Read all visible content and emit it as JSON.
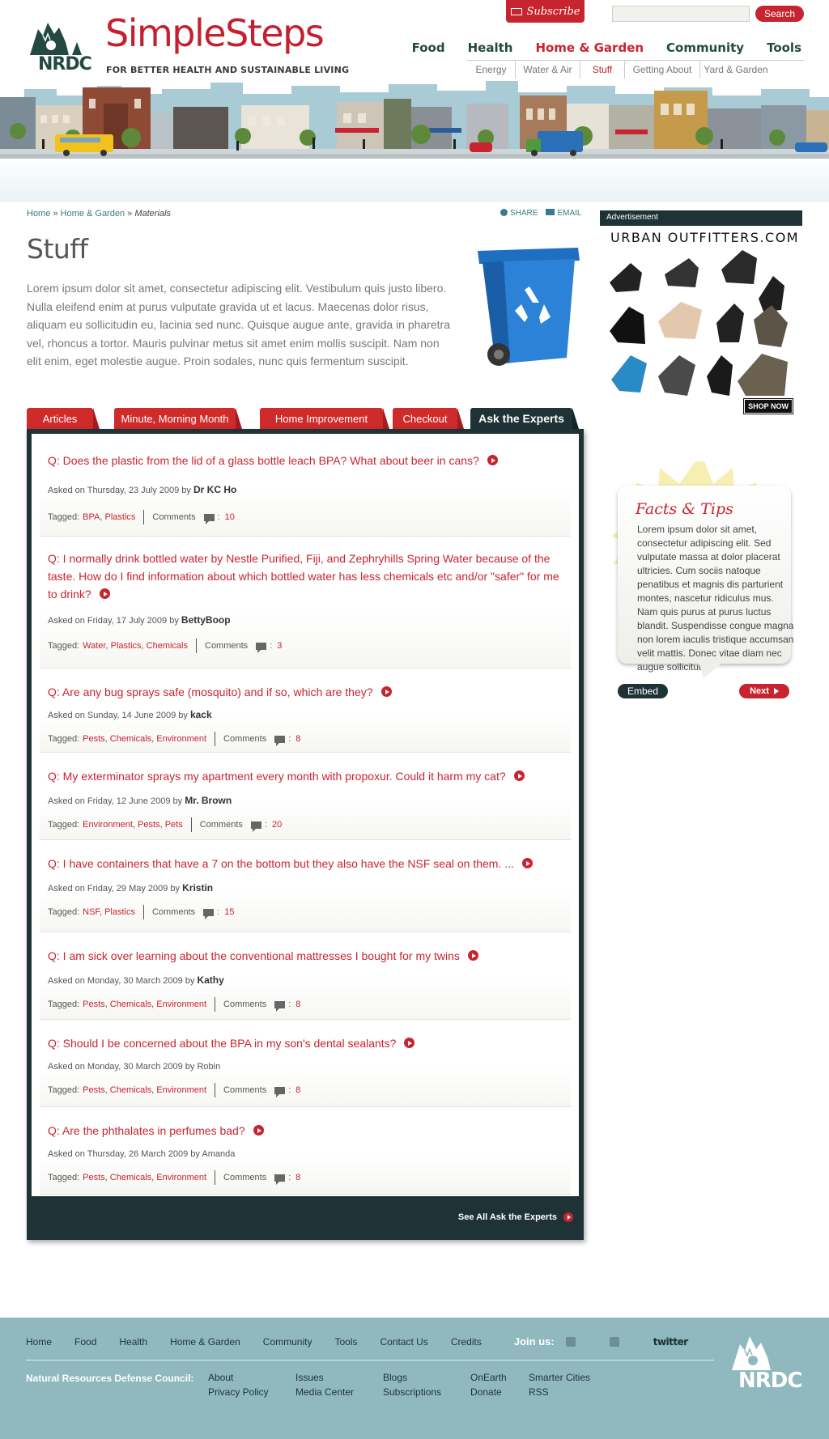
{
  "header": {
    "logo_text": "NRDC",
    "brand": "SimpleSteps",
    "tagline": "FOR BETTER HEALTH AND SUSTAINABLE LIVING",
    "subscribe_label": "Subscribe",
    "search_placeholder": "",
    "search_button": "Search"
  },
  "main_nav": [
    {
      "label": "Food",
      "active": false
    },
    {
      "label": "Health",
      "active": false
    },
    {
      "label": "Home & Garden",
      "active": true
    },
    {
      "label": "Community",
      "active": false
    },
    {
      "label": "Tools",
      "active": false
    }
  ],
  "sub_nav": [
    {
      "label": "Energy",
      "active": false
    },
    {
      "label": "Water & Air",
      "active": false
    },
    {
      "label": "Stuff",
      "active": true
    },
    {
      "label": "Getting About",
      "active": false
    },
    {
      "label": "Yard & Garden",
      "active": false
    }
  ],
  "breadcrumb": {
    "home": "Home",
    "sep": "»",
    "section": "Home & Garden",
    "current": "Materials"
  },
  "share": {
    "share_label": "SHARE",
    "email_label": "EMAIL"
  },
  "page": {
    "title": "Stuff",
    "intro": "Lorem ipsum dolor sit amet, consectetur adipiscing elit. Vestibulum quis justo libero. Nulla eleifend enim at purus vulputate gravida ut et lacus. Maecenas dolor risus, aliquam eu sollicitudin eu, lacinia sed nunc. Quisque augue ante, gravida in pharetra vel, rhoncus a tortor. Mauris pulvinar metus sit amet enim mollis suscipit. Nam non elit enim, eget molestie augue. Proin sodales, nunc quis fermentum suscipit."
  },
  "tabs": [
    {
      "label": "Articles",
      "active": false
    },
    {
      "label": "Minute, Morning Month",
      "active": false
    },
    {
      "label": "Home Improvement",
      "active": false
    },
    {
      "label": "Checkout",
      "active": false
    },
    {
      "label": "Ask the Experts",
      "active": true
    }
  ],
  "questions": [
    {
      "question": "Q: Does the plastic from the lid of a glass bottle leach BPA? What about beer in cans?",
      "asked": "Asked on Thursday, 23 July 2009 by",
      "author": "Dr KC Ho",
      "author_bold": true,
      "tagged_label": "Tagged:",
      "tags": [
        "BPA",
        "Plastics"
      ],
      "comments_label": "Comments",
      "comments": "10"
    },
    {
      "question": "Q: I normally drink bottled water by Nestle Purified, Fiji, and Zephryhills Spring Water because of the taste. How do I find information about which bottled water has less chemicals etc and/or \"safer\" for me to drink?",
      "asked": "Asked on Friday, 17 July 2009 by",
      "author": "BettyBoop",
      "author_bold": true,
      "tagged_label": "Tagged:",
      "tags": [
        "Water",
        "Plastics",
        "Chemicals"
      ],
      "comments_label": "Comments",
      "comments": "3"
    },
    {
      "question": "Q: Are any bug sprays safe (mosquito) and if so, which are they?",
      "asked": "Asked on Sunday, 14 June 2009 by",
      "author": "kack",
      "author_bold": true,
      "tagged_label": "Tagged:",
      "tags": [
        "Pests",
        "Chemicals",
        "Environment"
      ],
      "comments_label": "Comments",
      "comments": "8"
    },
    {
      "question": "Q: My exterminator sprays my apartment every month with propoxur. Could it harm my cat?",
      "asked": "Asked on Friday, 12 June 2009 by",
      "author": "Mr. Brown",
      "author_bold": true,
      "tagged_label": "Tagged:",
      "tags": [
        "Environment",
        "Pests",
        "Pets"
      ],
      "comments_label": "Comments",
      "comments": "20"
    },
    {
      "question": "Q: I have containers that have a 7 on the bottom but they also have the NSF seal on them. ...",
      "asked": "Asked on Friday, 29 May 2009 by",
      "author": "Kristin",
      "author_bold": true,
      "tagged_label": "Tagged:",
      "tags": [
        "NSF",
        "Plastics"
      ],
      "comments_label": "Comments",
      "comments": "15"
    },
    {
      "question": "Q: I am sick over learning about the conventional mattresses I bought for my twins",
      "asked": "Asked on Monday, 30 March 2009 by",
      "author": "Kathy",
      "author_bold": true,
      "tagged_label": "Tagged:",
      "tags": [
        "Pests",
        "Chemicals",
        "Environment"
      ],
      "comments_label": "Comments",
      "comments": "8"
    },
    {
      "question": "Q: Should I be concerned about the BPA in my son's dental sealants?",
      "asked": "Asked on Monday, 30 March 2009 by",
      "author": "Robin",
      "author_bold": false,
      "tagged_label": "Tagged:",
      "tags": [
        "Pests",
        "Chemicals",
        "Environment"
      ],
      "comments_label": "Comments",
      "comments": "8"
    },
    {
      "question": "Q: Are the phthalates in perfumes bad?",
      "asked": "Asked on Thursday, 26 March 2009 by",
      "author": "Amanda",
      "author_bold": false,
      "tagged_label": "Tagged:",
      "tags": [
        "Pests",
        "Chemicals",
        "Environment"
      ],
      "comments_label": "Comments",
      "comments": "8"
    }
  ],
  "see_all": "See All Ask the Experts",
  "sidebar": {
    "ad_label": "Advertisement",
    "ad_title": "URBAN OUTFITTERS.COM",
    "ad_cta": "SHOP NOW",
    "facts_title": "Facts & Tips",
    "facts_text": "Lorem ipsum dolor sit amet, consectetur adipiscing elit. Sed vulputate massa at dolor placerat ultricies. Cum sociis natoque penatibus et magnis dis parturient montes, nascetur ridiculus mus. Nam quis purus at purus luctus blandit. Suspendisse congue magna non lorem iaculis tristique accumsan velit mattis. Donec vitae diam nec augue sollicitudin.",
    "embed_label": "Embed",
    "next_label": "Next"
  },
  "footer": {
    "nav": [
      "Home",
      "Food",
      "Health",
      "Home & Garden",
      "Community",
      "Tools",
      "Contact Us",
      "Credits"
    ],
    "join_label": "Join us:",
    "twitter_label": "twitter",
    "org": "Natural Resources Defense Council:",
    "links": [
      "About",
      "Issues",
      "Blogs",
      "OnEarth",
      "Smarter Cities",
      "Privacy Policy",
      "Media Center",
      "Subscriptions",
      "Donate",
      "RSS"
    ],
    "logo_text": "NRDC"
  },
  "colors": {
    "brand_red": "#c8242f",
    "dark_teal": "#1f3336",
    "footer_teal": "#8fb9bf",
    "link_teal": "#3a7a8a"
  },
  "icons": [
    "subscribe-envelope-icon",
    "share-plus-icon",
    "email-icon",
    "play-arrow-icon",
    "comment-bubble-icon",
    "rss-icon",
    "facebook-icon"
  ]
}
